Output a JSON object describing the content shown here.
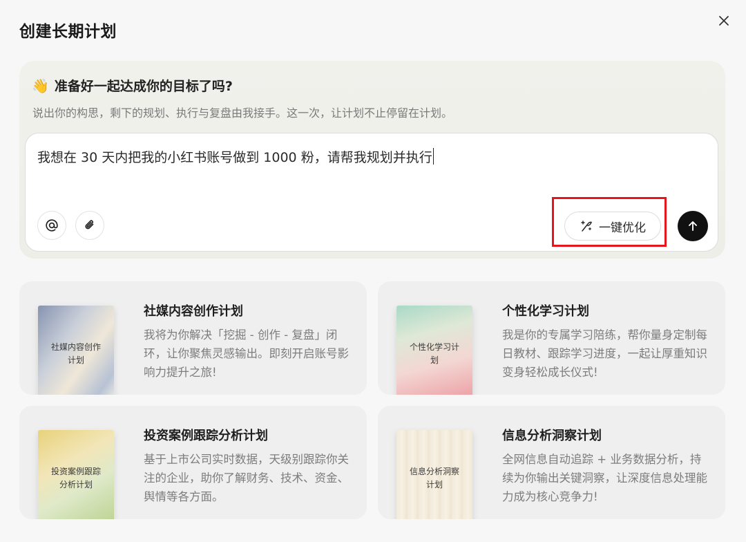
{
  "dialog": {
    "title": "创建长期计划",
    "close_icon": "close-icon"
  },
  "hero": {
    "emoji": "👋",
    "heading": "准备好一起达成你的目标了吗?",
    "subtitle": "说出你的构思，剩下的规划、执行与复盘由我接手。这一次，让计划不止停留在计划。"
  },
  "composer": {
    "value": "我想在 30 天内把我的小红书账号做到 1000 粉，请帮我规划并执行",
    "mention_icon": "at-icon",
    "attach_icon": "paperclip-icon",
    "optimize_label": "一键优化",
    "optimize_icon": "sparkle-pen-icon",
    "send_icon": "arrow-up-icon",
    "highlight_color": "#e4161b"
  },
  "cards": [
    {
      "cover_text": "社媒内容创作计划",
      "title": "社媒内容创作计划",
      "description": "我将为你解决「挖掘 - 创作 - 复盘」闭环，让你聚焦灵感输出。即刻开启账号影响力提升之旅!"
    },
    {
      "cover_text": "个性化学习计划",
      "title": "个性化学习计划",
      "description": "我是你的专属学习陪练，帮你量身定制每日教材、跟踪学习进度，一起让厚重知识变身轻松成长仪式!"
    },
    {
      "cover_text": "投资案例跟踪分析计划",
      "title": "投资案例跟踪分析计划",
      "description": "基于上市公司实时数据，天级别跟踪你关注的企业，助你了解财务、技术、资金、舆情等各方面。"
    },
    {
      "cover_text": "信息分析洞察计划",
      "title": "信息分析洞察计划",
      "description": "全网信息自动追踪 + 业务数据分析，持续为你输出关键洞察，让深度信息处理能力成为核心竞争力!"
    }
  ]
}
